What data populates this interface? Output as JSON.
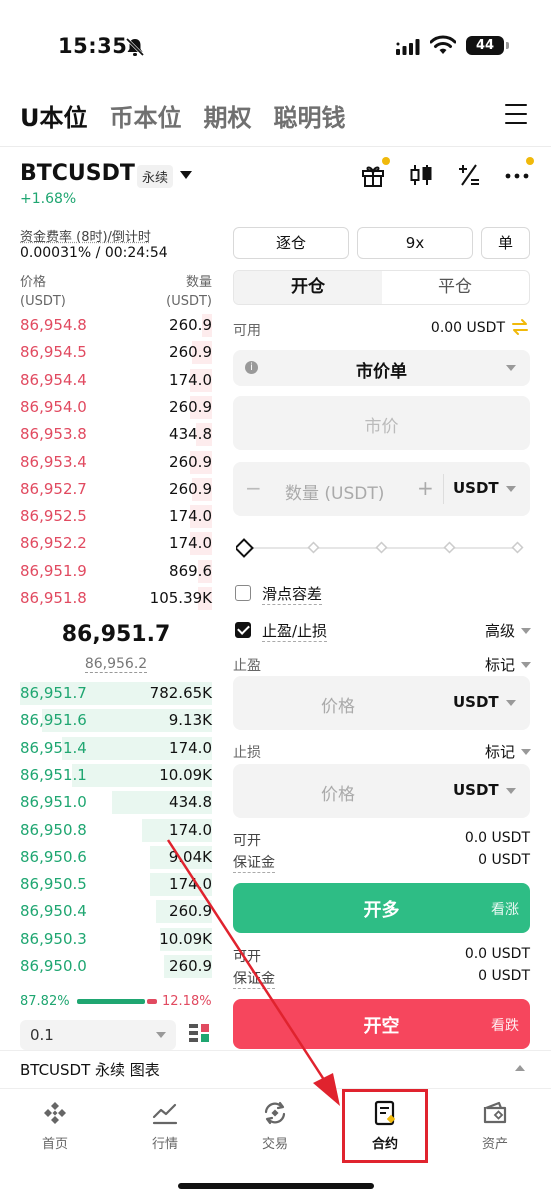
{
  "status": {
    "time": "15:35",
    "battery": "44"
  },
  "top_tabs": [
    "U本位",
    "币本位",
    "期权",
    "聪明钱"
  ],
  "pair": {
    "symbol": "BTCUSDT",
    "badge": "永续",
    "change": "+1.68%"
  },
  "funding": {
    "label": "资金费率 (8时)/倒计时",
    "value": "0.00031% / 00:24:54"
  },
  "orderbook": {
    "price_header": "价格",
    "price_unit": "(USDT)",
    "qty_header": "数量",
    "qty_unit": "(USDT)",
    "asks": [
      {
        "price": "86,954.8",
        "qty": "260.9"
      },
      {
        "price": "86,954.5",
        "qty": "260.9"
      },
      {
        "price": "86,954.4",
        "qty": "174.0"
      },
      {
        "price": "86,954.0",
        "qty": "260.9"
      },
      {
        "price": "86,953.8",
        "qty": "434.8"
      },
      {
        "price": "86,953.4",
        "qty": "260.9"
      },
      {
        "price": "86,952.7",
        "qty": "260.9"
      },
      {
        "price": "86,952.5",
        "qty": "174.0"
      },
      {
        "price": "86,952.2",
        "qty": "174.0"
      },
      {
        "price": "86,951.9",
        "qty": "869.6"
      },
      {
        "price": "86,951.8",
        "qty": "105.39K"
      }
    ],
    "last_price": "86,951.7",
    "mark_price": "86,956.2",
    "bids": [
      {
        "price": "86,951.7",
        "qty": "782.65K"
      },
      {
        "price": "86,951.6",
        "qty": "9.13K"
      },
      {
        "price": "86,951.4",
        "qty": "174.0"
      },
      {
        "price": "86,951.1",
        "qty": "10.09K"
      },
      {
        "price": "86,951.0",
        "qty": "434.8"
      },
      {
        "price": "86,950.8",
        "qty": "174.0"
      },
      {
        "price": "86,950.6",
        "qty": "9.04K"
      },
      {
        "price": "86,950.5",
        "qty": "174.0"
      },
      {
        "price": "86,950.4",
        "qty": "260.9"
      },
      {
        "price": "86,950.3",
        "qty": "10.09K"
      },
      {
        "price": "86,950.0",
        "qty": "260.9"
      }
    ],
    "buy_ratio": "87.82%",
    "sell_ratio": "12.18%",
    "depth": "0.1"
  },
  "form": {
    "margin_mode": "逐仓",
    "leverage": "9x",
    "position_mode": "单",
    "open_tab": "开仓",
    "close_tab": "平仓",
    "available_label": "可用",
    "available_value": "0.00 USDT",
    "order_type": "市价单",
    "market_placeholder": "市价",
    "qty_placeholder": "数量 (USDT)",
    "qty_minus": "−",
    "qty_plus": "+",
    "unit": "USDT",
    "slippage_label": "滑点容差",
    "tpsl_label": "止盈/止损",
    "advanced_label": "高级",
    "tp_label": "止盈",
    "sl_label": "止损",
    "mark_label": "标记",
    "price_placeholder": "价格",
    "can_open_label": "可开",
    "margin_label": "保证金",
    "long_can_open": "0.0 USDT",
    "long_margin": "0 USDT",
    "short_can_open": "0.0 USDT",
    "short_margin": "0 USDT",
    "long_button": "开多",
    "long_sub": "看涨",
    "short_button": "开空",
    "short_sub": "看跌"
  },
  "chart_bar": {
    "label": "BTCUSDT 永续  图表"
  },
  "nav": [
    "首页",
    "行情",
    "交易",
    "合约",
    "资产"
  ],
  "colors": {
    "green": "#2ebd85",
    "red": "#f6465d",
    "accent": "#f0b90b",
    "highlight": "#e0232e"
  }
}
